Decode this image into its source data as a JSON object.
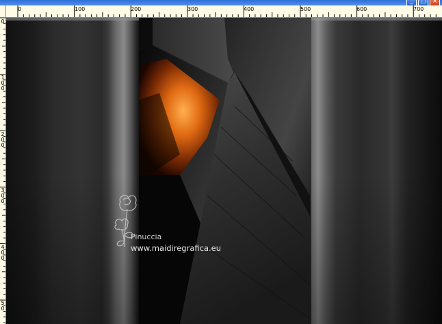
{
  "window": {
    "buttons": [
      {
        "name": "minimize-button",
        "glyph": "_"
      },
      {
        "name": "maximize-button",
        "glyph": "□"
      },
      {
        "name": "close-button",
        "glyph": "×"
      }
    ]
  },
  "ruler": {
    "top_labels": [
      "0",
      "100",
      "200",
      "300",
      "400",
      "500",
      "600",
      "700"
    ],
    "left_labels": [
      "0",
      "1\n0\n0",
      "2\n0\n0",
      "3\n0\n0",
      "4\n0\n0",
      "5\n0"
    ]
  },
  "watermark": {
    "name": "Pinuccia",
    "url": "www.maidiregrafica.eu",
    "icon": "rose-icon"
  },
  "colors": {
    "ruler_bg": "#fffbe6",
    "accent_orange": "#e67a1a",
    "titlebar": "#2f6fd8"
  }
}
